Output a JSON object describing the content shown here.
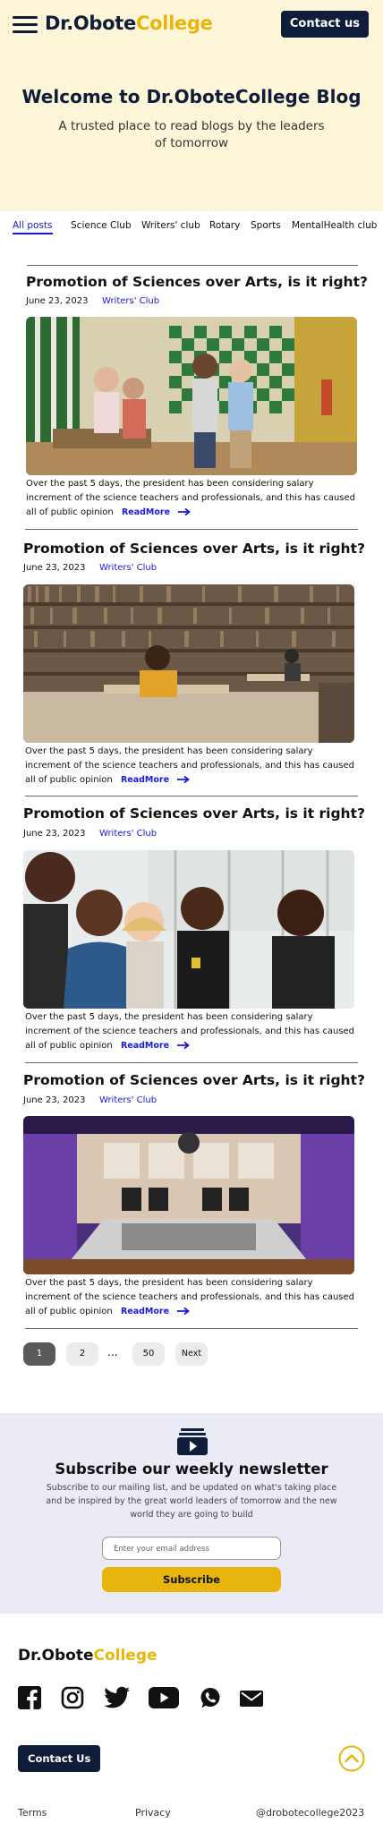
{
  "header": {
    "logo_dr": "Dr.Obote",
    "logo_college": "College",
    "contact_label": "Contact us"
  },
  "hero": {
    "title": "Welcome to Dr.OboteCollege Blog",
    "subtitle": "A trusted place to read blogs by the leaders of tomorrow"
  },
  "tabs": [
    {
      "label": "All posts",
      "active": true
    },
    {
      "label": "Science Club"
    },
    {
      "label": "Writers' club"
    },
    {
      "label": "Rotary"
    },
    {
      "label": "Sports"
    },
    {
      "label": "MentalHealth club"
    }
  ],
  "posts": [
    {
      "title": "Promotion of Sciences over Arts, is it right?",
      "date": "June 23, 2023",
      "club": "Writers' Club",
      "excerpt": "Over the past 5 days, the president has been considering salary increment of the science teachers and professionals, and this has caused all of public opinion",
      "readmore": "ReadMore"
    },
    {
      "title": "Promotion of Sciences over Arts, is it right?",
      "date": "June 23, 2023",
      "club": "Writers' Club",
      "excerpt": "Over the past 5 days, the president has been considering salary increment of the science teachers and professionals, and this has caused all of public opinion",
      "readmore": "ReadMore"
    },
    {
      "title": "Promotion of Sciences over Arts, is it right?",
      "date": "June 23, 2023",
      "club": "Writers' Club",
      "excerpt": "Over the past 5 days, the president has been considering salary increment of the science teachers and professionals, and this has caused all of public opinion",
      "readmore": "ReadMore"
    },
    {
      "title": "Promotion of Sciences over Arts, is it right?",
      "date": "June 23, 2023",
      "club": "Writers' Club",
      "excerpt": "Over the past 5 days, the president has been considering salary increment of the science teachers and professionals, and this has caused all of public opinion",
      "readmore": "ReadMore"
    }
  ],
  "pagination": {
    "pages": [
      "1",
      "2",
      "...",
      "50"
    ],
    "current": "1",
    "next": "Next"
  },
  "newsletter": {
    "title": "Subscribe our weekly newsletter",
    "description": "Subscribe to our mailing list, and be updated on what's taking place and be inspired by the great world leaders of tomorrow and the new world they are going to build",
    "placeholder": "Enter your email address",
    "button": "Subscribe"
  },
  "footer": {
    "logo_dr": "Dr.Obote",
    "logo_college": "College",
    "contact_label": "Contact Us",
    "terms": "Terms",
    "privacy": "Privacy",
    "handle": "@drobotecollege2023"
  },
  "icons": [
    "menu-icon",
    "newsletter-icon",
    "facebook-icon",
    "instagram-icon",
    "twitter-icon",
    "youtube-icon",
    "whatsapp-icon",
    "mail-icon",
    "arrow-up-icon",
    "arrow-right-icon"
  ],
  "colors": {
    "navy": "#0f1d3a",
    "gold": "#e8b50c",
    "link": "#1a1ad9",
    "hero_bg": "#fdf6d8",
    "newsletter_bg": "#ebebf6"
  }
}
